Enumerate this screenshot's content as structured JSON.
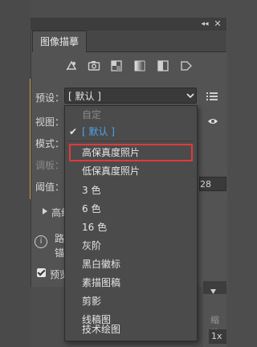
{
  "panel": {
    "title_tab": "图像描摹",
    "toolbar_icons": [
      "auto-color-icon",
      "photo-camera-icon",
      "squares-icon",
      "gradient-square-icon",
      "half-square-icon",
      "tag-outline-icon"
    ]
  },
  "labels": {
    "preset": "预设：",
    "view": "视图：",
    "mode": "模式：",
    "palette": "调板：",
    "threshold": "阈值：",
    "advanced": "高级",
    "info_line1": "路",
    "info_line2": "锚",
    "preview": "预览"
  },
  "preset_select": {
    "value": "[ 默认 ]"
  },
  "threshold_value": "28",
  "dropdown": {
    "items": [
      {
        "label": "自定",
        "state": "disabled"
      },
      {
        "label": "[ 默认 ]",
        "state": "selected",
        "check": "✔"
      },
      {
        "label": "高保真度照片",
        "state": "highlighted"
      },
      {
        "label": "低保真度照片",
        "state": "normal"
      },
      {
        "label": "3 色",
        "state": "normal"
      },
      {
        "label": "6 色",
        "state": "normal"
      },
      {
        "label": "16 色",
        "state": "normal"
      },
      {
        "label": "灰阶",
        "state": "normal"
      },
      {
        "label": "黑白徽标",
        "state": "normal"
      },
      {
        "label": "素描图稿",
        "state": "normal"
      },
      {
        "label": "剪影",
        "state": "normal"
      },
      {
        "label": "线稿图",
        "state": "normal"
      },
      {
        "label": "技术绘图",
        "state": "normal"
      }
    ]
  },
  "bottom_right": {
    "scale_label": "缩放",
    "scale_value": "1x"
  },
  "colors": {
    "highlight_border": "#e03a3a",
    "selected_text": "#4aa6f0",
    "accent_line": "#c9a23a"
  }
}
